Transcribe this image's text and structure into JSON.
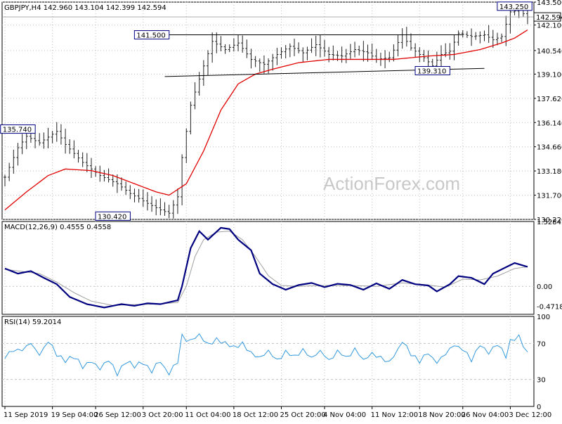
{
  "colors": {
    "price_bars": "#1f1f1f",
    "moving_average": "#e00000",
    "macd_line": "#000080",
    "macd_signal": "#a0a0a0",
    "rsi_line": "#3399dd",
    "grid": "#c0c0c0",
    "label_border": "#000080"
  },
  "chart_data": [
    {
      "type": "candlestick",
      "title": "GBPJPY,H4 142.960 143.104 142.399 142.594",
      "current_price_label": "142.594",
      "ylim": [
        130.22,
        143.5
      ],
      "y_ticks": [
        143.5,
        142.1,
        140.54,
        139.1,
        137.62,
        136.14,
        134.66,
        133.18,
        131.7,
        130.22
      ],
      "y_tick_labels": [
        "143.500",
        "142.100",
        "140.540",
        "139.100",
        "137.620",
        "136.140",
        "134.660",
        "133.180",
        "131.700",
        "130.220"
      ],
      "current_price": 142.594,
      "watermark": "ActionForex.com",
      "annotations": [
        {
          "text": "135.740",
          "value": 135.74,
          "bar": 3
        },
        {
          "text": "130.420",
          "value": 130.42,
          "bar": 25
        },
        {
          "text": "141.500",
          "value": 141.5,
          "bar": 34
        },
        {
          "text": "139.310",
          "value": 139.31,
          "bar": 99
        },
        {
          "text": "143.250",
          "value": 143.25,
          "bar": 118
        }
      ],
      "trendlines": [
        {
          "from": {
            "bar": 34,
            "y": 141.5
          },
          "to": {
            "bar": 106,
            "y": 141.5
          }
        },
        {
          "from": {
            "bar": 37,
            "y": 138.95
          },
          "to": {
            "bar": 111,
            "y": 139.45
          }
        }
      ],
      "x_tick_labels": [
        "11 Sep 2019",
        "19 Sep 04:00",
        "26 Sep 12:00",
        "3 Oct 20:00",
        "11 Oct 04:00",
        "18 Oct 12:00",
        "25 Oct 20:00",
        "4 Nov 04:00",
        "11 Nov 12:00",
        "18 Nov 20:00",
        "26 Nov 04:00",
        "3 Dec 12:00"
      ],
      "bar_count": 122,
      "close_anchors": [
        [
          0,
          132.8
        ],
        [
          3,
          134.6
        ],
        [
          5,
          135.3
        ],
        [
          8,
          134.9
        ],
        [
          12,
          135.6
        ],
        [
          14,
          134.8
        ],
        [
          18,
          133.7
        ],
        [
          22,
          132.9
        ],
        [
          26,
          132.4
        ],
        [
          29,
          131.8
        ],
        [
          33,
          131.2
        ],
        [
          36,
          130.8
        ],
        [
          38,
          130.6
        ],
        [
          40,
          131.6
        ],
        [
          41,
          134.0
        ],
        [
          43,
          137.2
        ],
        [
          46,
          139.6
        ],
        [
          48,
          141.1
        ],
        [
          51,
          140.6
        ],
        [
          54,
          141.0
        ],
        [
          57,
          140.0
        ],
        [
          60,
          139.7
        ],
        [
          63,
          140.3
        ],
        [
          66,
          140.8
        ],
        [
          69,
          140.4
        ],
        [
          72,
          140.9
        ],
        [
          75,
          140.3
        ],
        [
          78,
          140.2
        ],
        [
          81,
          140.6
        ],
        [
          84,
          140.4
        ],
        [
          86,
          140.0
        ],
        [
          89,
          140.1
        ],
        [
          92,
          141.5
        ],
        [
          94,
          140.7
        ],
        [
          97,
          140.1
        ],
        [
          99,
          139.6
        ],
        [
          101,
          140.3
        ],
        [
          103,
          140.5
        ],
        [
          105,
          141.6
        ],
        [
          108,
          141.4
        ],
        [
          111,
          141.5
        ],
        [
          113,
          141.2
        ],
        [
          115,
          141.4
        ],
        [
          117,
          142.9
        ],
        [
          119,
          143.0
        ],
        [
          121,
          142.59
        ]
      ],
      "ma_anchors": [
        [
          0,
          130.8
        ],
        [
          5,
          131.9
        ],
        [
          10,
          132.9
        ],
        [
          14,
          133.3
        ],
        [
          20,
          133.2
        ],
        [
          25,
          132.9
        ],
        [
          30,
          132.4
        ],
        [
          35,
          131.9
        ],
        [
          38,
          131.7
        ],
        [
          42,
          132.4
        ],
        [
          46,
          134.4
        ],
        [
          50,
          136.9
        ],
        [
          54,
          138.5
        ],
        [
          58,
          139.1
        ],
        [
          62,
          139.4
        ],
        [
          68,
          139.8
        ],
        [
          75,
          140.0
        ],
        [
          82,
          140.0
        ],
        [
          90,
          140.0
        ],
        [
          98,
          140.2
        ],
        [
          104,
          140.3
        ],
        [
          110,
          140.6
        ],
        [
          115,
          141.0
        ],
        [
          118,
          141.3
        ],
        [
          121,
          141.8
        ]
      ]
    },
    {
      "type": "line",
      "title": "MACD(12,26,9) 0.4555 0.4558",
      "ylim": [
        -0.66,
        1.5284
      ],
      "y_ticks": [
        1.5284,
        0.0,
        -0.4718
      ],
      "y_tick_labels": [
        "1.5284",
        "0.00",
        "-0.4718"
      ],
      "macd_anchors": [
        [
          0,
          0.42
        ],
        [
          3,
          0.3
        ],
        [
          6,
          0.36
        ],
        [
          9,
          0.2
        ],
        [
          12,
          0.05
        ],
        [
          15,
          -0.25
        ],
        [
          19,
          -0.42
        ],
        [
          23,
          -0.5
        ],
        [
          27,
          -0.42
        ],
        [
          30,
          -0.46
        ],
        [
          33,
          -0.4
        ],
        [
          36,
          -0.42
        ],
        [
          40,
          -0.33
        ],
        [
          41,
          0.0
        ],
        [
          43,
          0.9
        ],
        [
          45,
          1.3
        ],
        [
          47,
          1.1
        ],
        [
          50,
          1.38
        ],
        [
          52,
          1.35
        ],
        [
          54,
          1.1
        ],
        [
          57,
          0.85
        ],
        [
          59,
          0.3
        ],
        [
          62,
          0.05
        ],
        [
          65,
          -0.08
        ],
        [
          68,
          0.03
        ],
        [
          71,
          0.08
        ],
        [
          74,
          -0.02
        ],
        [
          77,
          0.06
        ],
        [
          80,
          0.03
        ],
        [
          83,
          -0.08
        ],
        [
          86,
          0.07
        ],
        [
          89,
          -0.06
        ],
        [
          92,
          0.15
        ],
        [
          95,
          0.05
        ],
        [
          98,
          0.02
        ],
        [
          100,
          -0.12
        ],
        [
          103,
          0.05
        ],
        [
          105,
          0.24
        ],
        [
          108,
          0.2
        ],
        [
          111,
          0.05
        ],
        [
          113,
          0.3
        ],
        [
          116,
          0.45
        ],
        [
          118,
          0.55
        ],
        [
          121,
          0.46
        ]
      ],
      "signal_anchors": [
        [
          0,
          0.4
        ],
        [
          4,
          0.35
        ],
        [
          8,
          0.3
        ],
        [
          12,
          0.1
        ],
        [
          16,
          -0.15
        ],
        [
          20,
          -0.35
        ],
        [
          25,
          -0.45
        ],
        [
          30,
          -0.43
        ],
        [
          35,
          -0.42
        ],
        [
          40,
          -0.38
        ],
        [
          42,
          0.0
        ],
        [
          44,
          0.7
        ],
        [
          46,
          1.1
        ],
        [
          49,
          1.28
        ],
        [
          52,
          1.3
        ],
        [
          55,
          1.1
        ],
        [
          58,
          0.7
        ],
        [
          61,
          0.25
        ],
        [
          64,
          0.02
        ],
        [
          68,
          0.0
        ],
        [
          74,
          0.02
        ],
        [
          80,
          0.02
        ],
        [
          86,
          0.0
        ],
        [
          92,
          0.08
        ],
        [
          98,
          0.03
        ],
        [
          102,
          -0.02
        ],
        [
          106,
          0.17
        ],
        [
          110,
          0.15
        ],
        [
          114,
          0.24
        ],
        [
          118,
          0.42
        ],
        [
          121,
          0.46
        ]
      ]
    },
    {
      "type": "line",
      "title": "RSI(14) 59.2014",
      "ylim": [
        0,
        100
      ],
      "y_ticks": [
        100,
        70,
        30,
        0
      ],
      "y_tick_labels": [
        "100",
        "70",
        "30",
        "0"
      ],
      "reference_lines": [
        70,
        30
      ],
      "rsi_anchors": [
        [
          0,
          55
        ],
        [
          2,
          64
        ],
        [
          4,
          63
        ],
        [
          6,
          70
        ],
        [
          8,
          58
        ],
        [
          10,
          72
        ],
        [
          12,
          58
        ],
        [
          14,
          50
        ],
        [
          16,
          56
        ],
        [
          18,
          44
        ],
        [
          20,
          50
        ],
        [
          22,
          42
        ],
        [
          24,
          52
        ],
        [
          26,
          36
        ],
        [
          28,
          50
        ],
        [
          30,
          45
        ],
        [
          32,
          48
        ],
        [
          34,
          40
        ],
        [
          36,
          50
        ],
        [
          38,
          36
        ],
        [
          40,
          50
        ],
        [
          41,
          78
        ],
        [
          43,
          72
        ],
        [
          45,
          80
        ],
        [
          47,
          70
        ],
        [
          49,
          74
        ],
        [
          51,
          70
        ],
        [
          53,
          66
        ],
        [
          55,
          70
        ],
        [
          57,
          60
        ],
        [
          59,
          54
        ],
        [
          61,
          62
        ],
        [
          63,
          52
        ],
        [
          65,
          60
        ],
        [
          67,
          55
        ],
        [
          69,
          64
        ],
        [
          71,
          52
        ],
        [
          73,
          62
        ],
        [
          75,
          52
        ],
        [
          77,
          60
        ],
        [
          79,
          55
        ],
        [
          81,
          63
        ],
        [
          83,
          52
        ],
        [
          85,
          60
        ],
        [
          87,
          54
        ],
        [
          89,
          50
        ],
        [
          91,
          62
        ],
        [
          92,
          74
        ],
        [
          94,
          58
        ],
        [
          96,
          50
        ],
        [
          98,
          60
        ],
        [
          100,
          48
        ],
        [
          102,
          58
        ],
        [
          104,
          68
        ],
        [
          106,
          64
        ],
        [
          108,
          52
        ],
        [
          110,
          70
        ],
        [
          112,
          60
        ],
        [
          114,
          70
        ],
        [
          116,
          56
        ],
        [
          117,
          74
        ],
        [
          119,
          78
        ],
        [
          121,
          59.2
        ]
      ]
    }
  ]
}
